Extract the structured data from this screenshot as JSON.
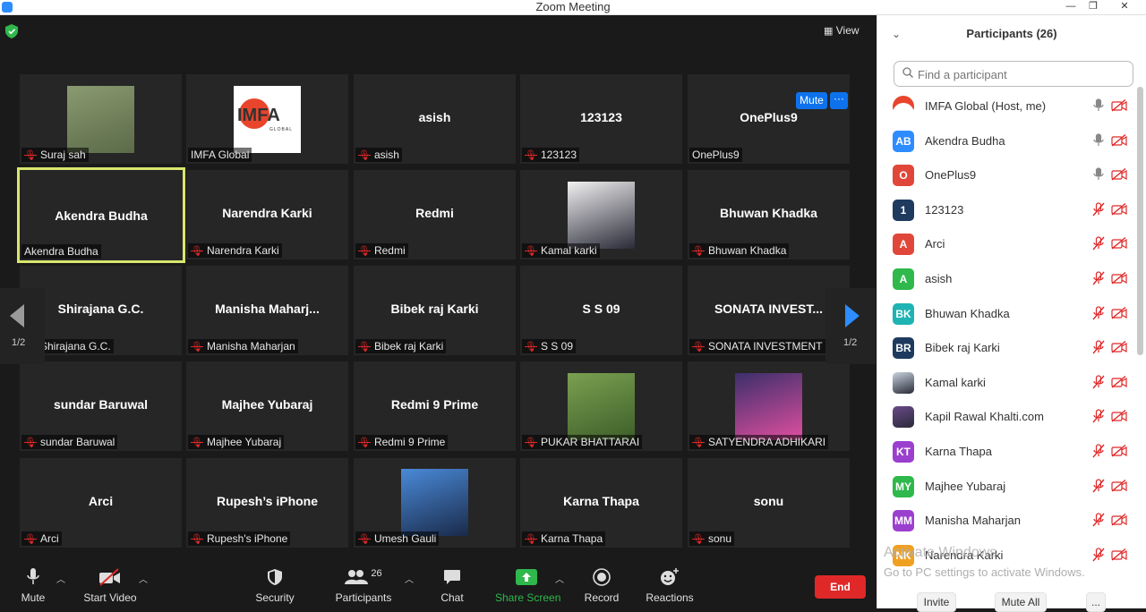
{
  "window": {
    "title": "Zoom Meeting",
    "minimize": "—",
    "restore": "❐",
    "close": "✕"
  },
  "top": {
    "view_label": "View",
    "shield_icon": "shield-check-icon"
  },
  "tiles": [
    {
      "big": "",
      "label": "Suraj sah",
      "muted": true
    },
    {
      "big": "",
      "label": "IMFA Global",
      "muted": false
    },
    {
      "big": "asish",
      "label": "asish",
      "muted": true
    },
    {
      "big": "123123",
      "label": "123123",
      "muted": true
    },
    {
      "big": "OnePlus9",
      "label": "OnePlus9",
      "muted": false
    },
    {
      "big": "Akendra Budha",
      "label": "Akendra Budha",
      "muted": false
    },
    {
      "big": "Narendra Karki",
      "label": "Narendra Karki",
      "muted": true
    },
    {
      "big": "Redmi",
      "label": "Redmi",
      "muted": true
    },
    {
      "big": "",
      "label": "Kamal karki",
      "muted": true
    },
    {
      "big": "Bhuwan Khadka",
      "label": "Bhuwan Khadka",
      "muted": true
    },
    {
      "big": "Shirajana G.C.",
      "label": "Shirajana G.C.",
      "muted": true
    },
    {
      "big": "Manisha  Maharj...",
      "label": "Manisha Maharjan",
      "muted": true
    },
    {
      "big": "Bibek raj Karki",
      "label": "Bibek raj Karki",
      "muted": true
    },
    {
      "big": "S S 09",
      "label": "S S 09",
      "muted": true
    },
    {
      "big": "SONATA  INVEST...",
      "label": "SONATA INVESTMENT",
      "muted": true
    },
    {
      "big": "sundar Baruwal",
      "label": "sundar Baruwal",
      "muted": true
    },
    {
      "big": "Majhee Yubaraj",
      "label": "Majhee Yubaraj",
      "muted": true
    },
    {
      "big": "Redmi 9 Prime",
      "label": "Redmi 9 Prime",
      "muted": true
    },
    {
      "big": "",
      "label": "PUKAR BHATTARAI",
      "muted": true
    },
    {
      "big": "",
      "label": "SATYENDRA ADHIKARI",
      "muted": true
    },
    {
      "big": "Arci",
      "label": "Arci",
      "muted": true
    },
    {
      "big": "Rupesh’s iPhone",
      "label": "Rupesh's iPhone",
      "muted": true
    },
    {
      "big": "",
      "label": "Umesh Gauli",
      "muted": true
    },
    {
      "big": "Karna Thapa",
      "label": "Karna Thapa",
      "muted": true
    },
    {
      "big": "sonu",
      "label": "sonu",
      "muted": true
    }
  ],
  "hover": {
    "mute_label": "Mute",
    "more_label": "···"
  },
  "paging": {
    "left_page": "1/2",
    "right_page": "1/2"
  },
  "toolbar": {
    "mute": "Mute",
    "start_video": "Start Video",
    "security": "Security",
    "participants": "Participants",
    "participants_count": "26",
    "chat": "Chat",
    "share_screen": "Share Screen",
    "record": "Record",
    "reactions": "Reactions",
    "end": "End"
  },
  "panel": {
    "title": "Participants (26)",
    "search_placeholder": "Find a participant",
    "participants": [
      {
        "initials": "",
        "name": "IMFA Global (Host, me)",
        "color": "#ffffff",
        "mic": "on",
        "avatar": "imfa-logo"
      },
      {
        "initials": "AB",
        "name": "Akendra Budha",
        "color": "#2d8cff",
        "mic": "on"
      },
      {
        "initials": "O",
        "name": "OnePlus9",
        "color": "#e0473a",
        "mic": "on"
      },
      {
        "initials": "1",
        "name": "123123",
        "color": "#1f3a5f",
        "mic": "off"
      },
      {
        "initials": "A",
        "name": "Arci",
        "color": "#e0473a",
        "mic": "off"
      },
      {
        "initials": "A",
        "name": "asish",
        "color": "#2fb84c",
        "mic": "off"
      },
      {
        "initials": "BK",
        "name": "Bhuwan Khadka",
        "color": "#1fb3b3",
        "mic": "off"
      },
      {
        "initials": "BR",
        "name": "Bibek raj Karki",
        "color": "#1f3a5f",
        "mic": "off"
      },
      {
        "initials": "",
        "name": "Kamal karki",
        "color": "#c8d4e0",
        "mic": "off",
        "avatar": "photo"
      },
      {
        "initials": "",
        "name": "Kapil Rawal Khalti.com",
        "color": "#6b4a8a",
        "mic": "off",
        "avatar": "photo"
      },
      {
        "initials": "KT",
        "name": "Karna Thapa",
        "color": "#9b3fcf",
        "mic": "off"
      },
      {
        "initials": "MY",
        "name": "Majhee Yubaraj",
        "color": "#2fb84c",
        "mic": "off"
      },
      {
        "initials": "MM",
        "name": "Manisha Maharjan",
        "color": "#9b3fcf",
        "mic": "off"
      },
      {
        "initials": "NK",
        "name": "Narendra Karki",
        "color": "#f0a020",
        "mic": "off"
      }
    ],
    "invite": "Invite",
    "mute_all": "Mute All",
    "more": "..."
  },
  "watermark": {
    "line1": "Activate Windows",
    "line2": "Go to PC settings to activate Windows."
  },
  "imfa_logo_text": "IMFA",
  "imfa_logo_sub": "GLOBAL",
  "colors": {
    "accent": "#0e72ed",
    "end": "#e02828",
    "share": "#2fb84c",
    "muted_red": "#e02828",
    "active_border": "#d9e66e"
  }
}
